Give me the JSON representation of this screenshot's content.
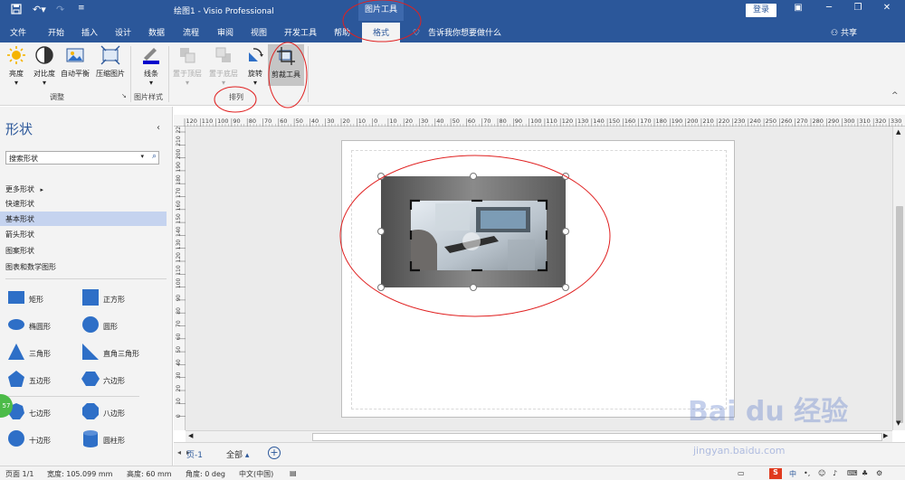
{
  "titlebar": {
    "doc_title": "绘图1  -  Visio Professional",
    "context_tool": "图片工具",
    "login": "登录"
  },
  "menu": {
    "tabs": [
      "文件",
      "开始",
      "插入",
      "设计",
      "数据",
      "流程",
      "审阅",
      "视图",
      "开发工具",
      "帮助"
    ],
    "active_tab": "格式",
    "tell_me": "告诉我你想要做什么",
    "share": "共享"
  },
  "ribbon": {
    "brightness": "亮度",
    "contrast": "对比度",
    "auto_balance": "自动平衡",
    "compress": "压缩图片",
    "group_adjust": "调整",
    "line": "线条",
    "group_picture_style": "图片样式",
    "bring_to_front": "置于顶层",
    "send_to_back": "置于底层",
    "rotate": "旋转",
    "crop_tool": "剪裁工具",
    "group_arrange": "排列"
  },
  "shapes_pane": {
    "title": "形状",
    "search_placeholder": "搜索形状",
    "more_shapes": "更多形状",
    "stencils": [
      "快速形状",
      "基本形状",
      "箭头形状",
      "图案形状",
      "图表和数学图形"
    ],
    "shapes": [
      "矩形",
      "正方形",
      "椭圆形",
      "圆形",
      "三角形",
      "直角三角形",
      "五边形",
      "六边形",
      "七边形",
      "八边形",
      "十边形",
      "圆柱形"
    ],
    "badge": "57"
  },
  "ruler": {
    "top": [
      "120",
      "110",
      "100",
      "90",
      "80",
      "70",
      "60",
      "50",
      "40",
      "30",
      "20",
      "10",
      "0",
      "10",
      "20",
      "30",
      "40",
      "50",
      "60",
      "70",
      "80",
      "90",
      "100",
      "110",
      "120",
      "130",
      "140",
      "150",
      "160",
      "170",
      "180",
      "190",
      "200",
      "210",
      "220",
      "230",
      "240",
      "250",
      "260",
      "270",
      "280",
      "290",
      "300",
      "310",
      "320",
      "330"
    ],
    "left": [
      "220",
      "210",
      "200",
      "190",
      "180",
      "170",
      "160",
      "150",
      "140",
      "130",
      "120",
      "110",
      "100",
      "90",
      "80",
      "70",
      "60",
      "50",
      "40",
      "30",
      "20",
      "10",
      "0"
    ]
  },
  "page_tabs": {
    "page1": "页-1",
    "all": "全部",
    "add": "+"
  },
  "status": {
    "page": "页面 1/1",
    "width": "宽度: 105.099 mm",
    "height": "高度: 60 mm",
    "angle": "角度: 0 deg",
    "language": "中文(中国)"
  },
  "watermark": {
    "brand": "Bai du 经验",
    "url": "jingyan.baidu.com"
  },
  "colors": {
    "accent": "#2b579a",
    "annotation": "#e02020",
    "selected_stencil": "#c5d3ef",
    "shape_fill": "#2e6fc7"
  }
}
